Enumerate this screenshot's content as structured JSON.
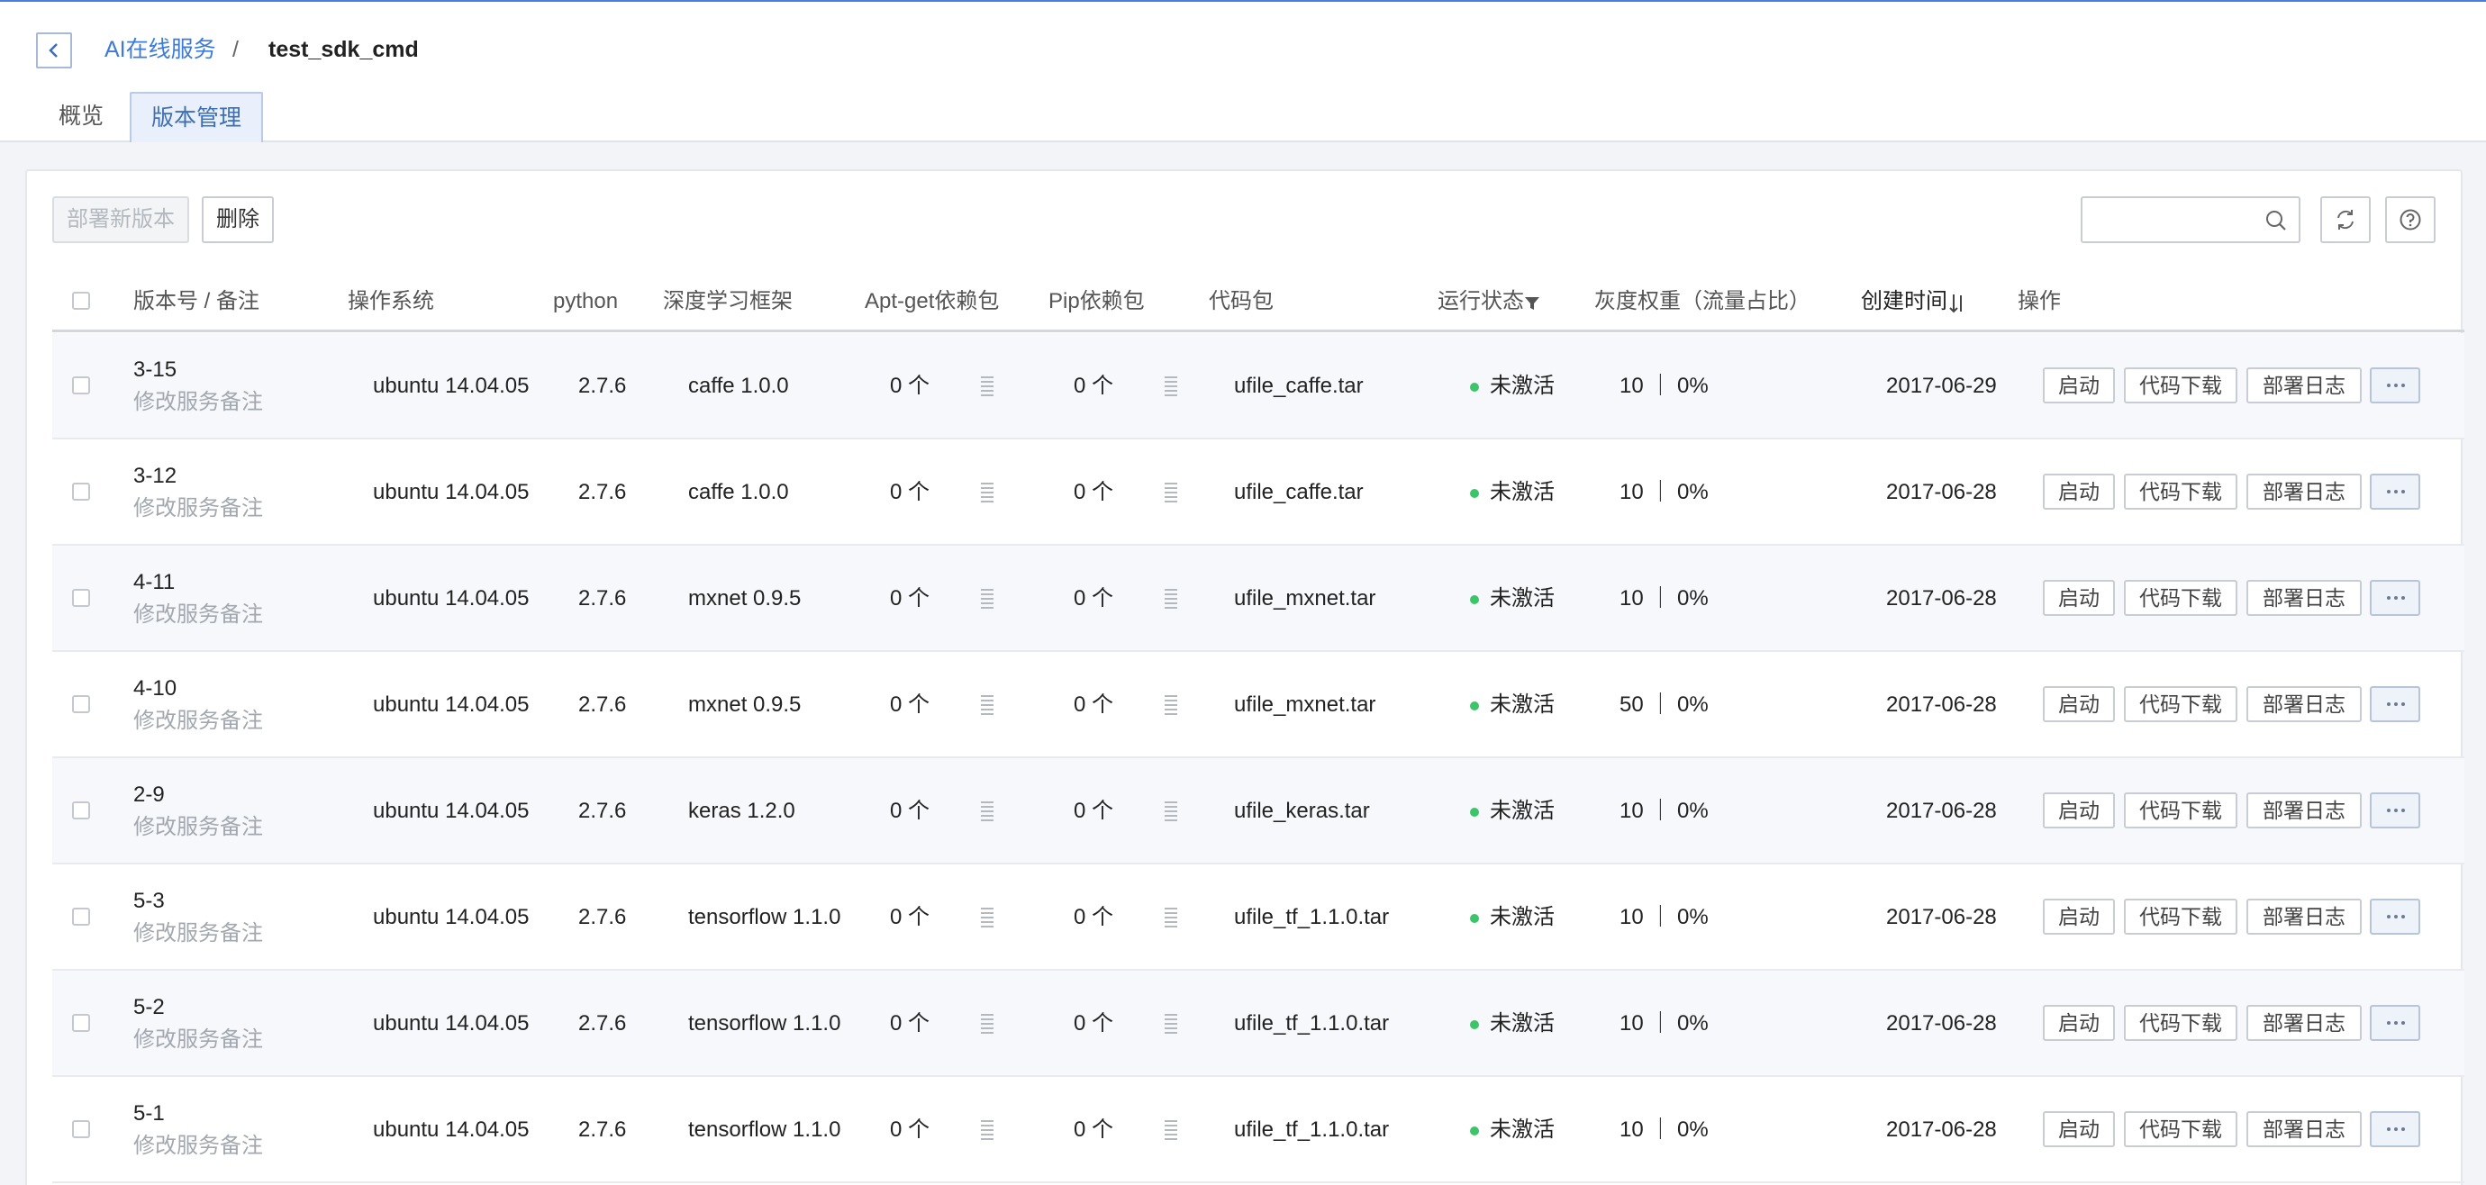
{
  "breadcrumb": {
    "parent": "AI在线服务",
    "separator": "/",
    "current": "test_sdk_cmd"
  },
  "tabs": [
    {
      "label": "概览",
      "active": false
    },
    {
      "label": "版本管理",
      "active": true
    }
  ],
  "toolbar": {
    "deploy_label": "部署新版本",
    "delete_label": "删除",
    "search_placeholder": ""
  },
  "table": {
    "headers": {
      "version": "版本号 / 备注",
      "os": "操作系统",
      "python": "python",
      "framework": "深度学习框架",
      "apt": "Apt-get依赖包",
      "pip": "Pip依赖包",
      "code": "代码包",
      "status": "运行状态",
      "weight": "灰度权重（流量占比）",
      "created": "创建时间",
      "actions": "操作"
    },
    "rows": [
      {
        "version": "3-15",
        "note": "修改服务备注",
        "os": "ubuntu 14.04.05",
        "python": "2.7.6",
        "framework": "caffe 1.0.0",
        "apt": "0 个",
        "pip": "0 个",
        "code": "ufile_caffe.tar",
        "status": "未激活",
        "weight": "10 ｜ 0%",
        "created": "2017-06-29"
      },
      {
        "version": "3-12",
        "note": "修改服务备注",
        "os": "ubuntu 14.04.05",
        "python": "2.7.6",
        "framework": "caffe 1.0.0",
        "apt": "0 个",
        "pip": "0 个",
        "code": "ufile_caffe.tar",
        "status": "未激活",
        "weight": "10 ｜ 0%",
        "created": "2017-06-28"
      },
      {
        "version": "4-11",
        "note": "修改服务备注",
        "os": "ubuntu 14.04.05",
        "python": "2.7.6",
        "framework": "mxnet 0.9.5",
        "apt": "0 个",
        "pip": "0 个",
        "code": "ufile_mxnet.tar",
        "status": "未激活",
        "weight": "10 ｜ 0%",
        "created": "2017-06-28"
      },
      {
        "version": "4-10",
        "note": "修改服务备注",
        "os": "ubuntu 14.04.05",
        "python": "2.7.6",
        "framework": "mxnet 0.9.5",
        "apt": "0 个",
        "pip": "0 个",
        "code": "ufile_mxnet.tar",
        "status": "未激活",
        "weight": "50 ｜ 0%",
        "created": "2017-06-28"
      },
      {
        "version": "2-9",
        "note": "修改服务备注",
        "os": "ubuntu 14.04.05",
        "python": "2.7.6",
        "framework": "keras 1.2.0",
        "apt": "0 个",
        "pip": "0 个",
        "code": "ufile_keras.tar",
        "status": "未激活",
        "weight": "10 ｜ 0%",
        "created": "2017-06-28"
      },
      {
        "version": "5-3",
        "note": "修改服务备注",
        "os": "ubuntu 14.04.05",
        "python": "2.7.6",
        "framework": "tensorflow 1.1.0",
        "apt": "0 个",
        "pip": "0 个",
        "code": "ufile_tf_1.1.0.tar",
        "status": "未激活",
        "weight": "10 ｜ 0%",
        "created": "2017-06-28"
      },
      {
        "version": "5-2",
        "note": "修改服务备注",
        "os": "ubuntu 14.04.05",
        "python": "2.7.6",
        "framework": "tensorflow 1.1.0",
        "apt": "0 个",
        "pip": "0 个",
        "code": "ufile_tf_1.1.0.tar",
        "status": "未激活",
        "weight": "10 ｜ 0%",
        "created": "2017-06-28"
      },
      {
        "version": "5-1",
        "note": "修改服务备注",
        "os": "ubuntu 14.04.05",
        "python": "2.7.6",
        "framework": "tensorflow 1.1.0",
        "apt": "0 个",
        "pip": "0 个",
        "code": "ufile_tf_1.1.0.tar",
        "status": "未激活",
        "weight": "10 ｜ 0%",
        "created": "2017-06-28"
      }
    ],
    "row_actions": {
      "start": "启动",
      "download": "代码下载",
      "log": "部署日志"
    }
  },
  "colors": {
    "accent": "#3d7bd9",
    "status_dot": "#3cc46a",
    "top_line": "#4a7fe0"
  },
  "icons": {
    "back": "chevron-left-icon",
    "search": "search-icon",
    "refresh": "refresh-icon",
    "help": "question-icon",
    "filter": "filter-icon",
    "sort": "sort-icon",
    "deps": "list-icon",
    "more": "more-icon"
  }
}
